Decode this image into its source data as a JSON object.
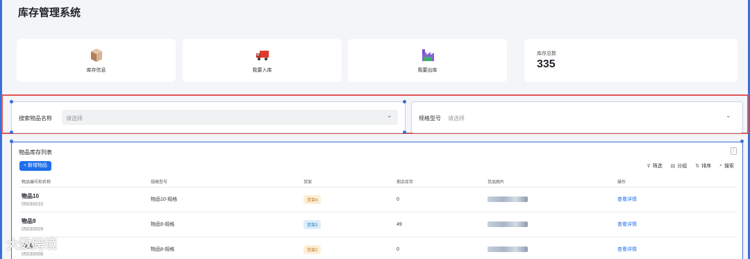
{
  "app": {
    "title": "库存管理系统"
  },
  "quick_actions": [
    {
      "label": "库存信息",
      "icon": "box-icon"
    },
    {
      "label": "我要入库",
      "icon": "truck-icon"
    },
    {
      "label": "我要出库",
      "icon": "factory-icon"
    }
  ],
  "stats": {
    "total_label": "库存总数",
    "total_value": "335"
  },
  "filters": [
    {
      "label": "搜索物品名称",
      "placeholder": "请选择"
    },
    {
      "label": "规格型号",
      "placeholder": "请选择"
    }
  ],
  "list": {
    "title": "物品库存列表",
    "add_button": "+ 新增物品",
    "toolbar": {
      "filter": "筛选",
      "group": "分组",
      "sort": "排序",
      "search": "搜索"
    },
    "columns": [
      "物品编号和名称",
      "规格型号",
      "货架",
      "剩余库存",
      "货品图片",
      "操作"
    ],
    "rows": [
      {
        "name": "物品10",
        "code": "05030010",
        "spec": "物品10-规格",
        "shelf": "货架4",
        "stock": "0",
        "action": "查看详情"
      },
      {
        "name": "物品9",
        "code": "05030009",
        "spec": "物品9-规格",
        "shelf": "货架3",
        "stock": "49",
        "action": "查看详情"
      },
      {
        "name": "物品8",
        "code": "05030008",
        "spec": "物品8-规格",
        "shelf": "货架2",
        "stock": "0",
        "action": "查看详情"
      }
    ]
  },
  "watermark": "大数跨境",
  "colors": {
    "accent": "#1f6feb",
    "selection_border": "#e25454",
    "frame": "#3b6fd8"
  }
}
